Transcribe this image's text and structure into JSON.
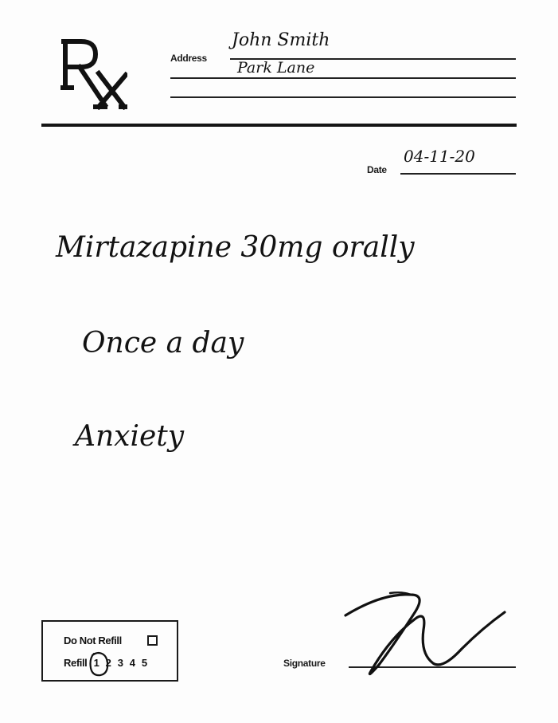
{
  "header": {
    "logo_text": "Rx",
    "address_label": "Address",
    "address_lines": [
      "John Smith",
      "Park Lane"
    ]
  },
  "date": {
    "label": "Date",
    "value": "04-11-20"
  },
  "prescription": {
    "lines": [
      "Mirtazapine 30mg orally",
      "Once a day",
      "Anxiety"
    ]
  },
  "refill": {
    "do_not_refill_label": "Do Not Refill",
    "refill_label": "Refill",
    "options": [
      "1",
      "2",
      "3",
      "4",
      "5"
    ],
    "selected": "1"
  },
  "signature": {
    "label": "Signature"
  }
}
